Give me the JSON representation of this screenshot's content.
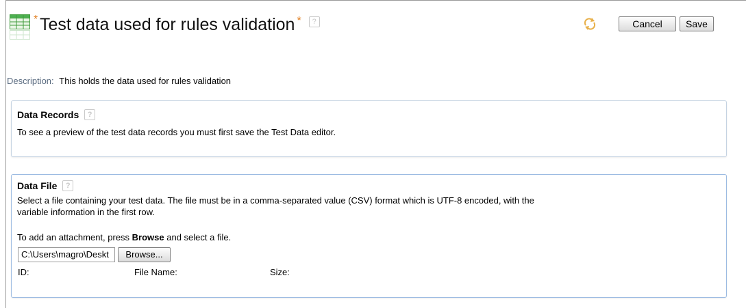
{
  "header": {
    "required_marker": "*",
    "title": "Test data used for rules validation",
    "help_glyph": "?",
    "cancel_label": "Cancel",
    "save_label": "Save"
  },
  "description": {
    "label": "Description:",
    "value": "This holds the data used for rules validation"
  },
  "data_records": {
    "title": "Data Records",
    "message": "To see a preview of the test data records you must first save the Test Data editor."
  },
  "data_file": {
    "title": "Data File",
    "instructions_line1": "Select a file containing your test data. The file must be in a comma-separated value (CSV) format which is UTF-8 encoded, with the",
    "instructions_line2": "variable information in the first row.",
    "attach_prefix": "To add an attachment, press ",
    "attach_bold": "Browse",
    "attach_suffix": " and select a file.",
    "file_path_value": "C:\\Users\\magro\\Deskt",
    "browse_label": "Browse...",
    "id_label": "ID:",
    "file_name_label": "File Name:",
    "size_label": "Size:"
  },
  "icons": {
    "table": "table-icon",
    "sync": "sync-icon",
    "help": "help-icon"
  },
  "colors": {
    "required": "#e07b1a",
    "panel_border": "#c5d3e2",
    "active_panel_border": "#9cbbe2",
    "label": "#5a6b80"
  }
}
